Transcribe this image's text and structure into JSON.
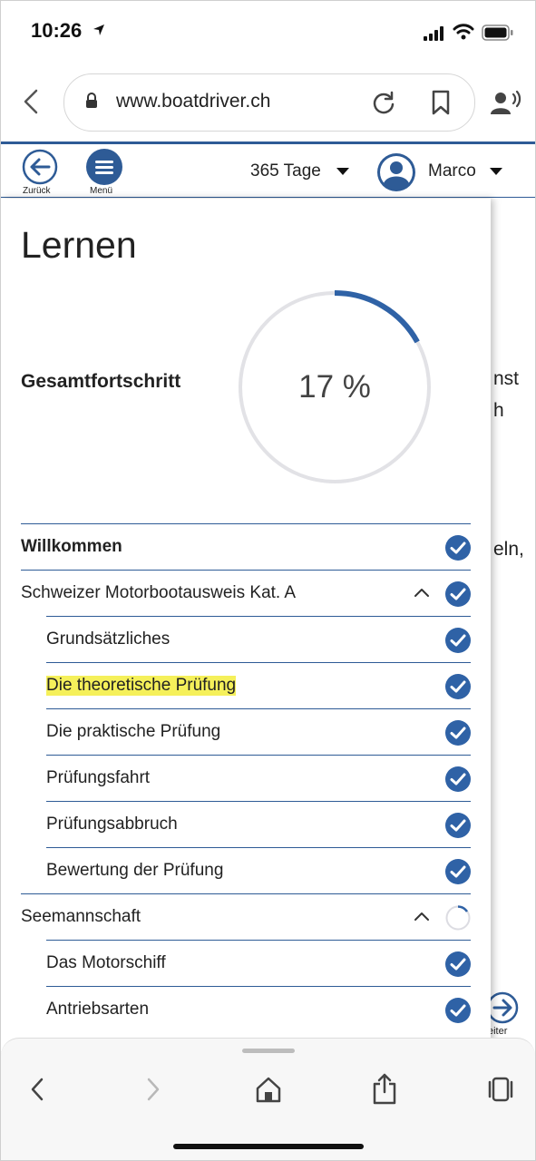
{
  "status_bar": {
    "time": "10:26"
  },
  "browser": {
    "url": "www.boatdriver.ch"
  },
  "header": {
    "back_label": "Zurück",
    "menu_label": "Menü",
    "days_label": "365 Tage",
    "user_name": "Marco"
  },
  "panel": {
    "title": "Lernen",
    "progress_label": "Gesamtfortschritt",
    "progress_text": "17 %",
    "progress_value": 17
  },
  "nav": [
    {
      "label": "Willkommen",
      "level": 0,
      "bold": true,
      "status": "done",
      "expanded": null,
      "highlight": false
    },
    {
      "label": "Schweizer Motorbootausweis Kat. A",
      "level": 0,
      "bold": false,
      "status": "done",
      "expanded": true,
      "highlight": false
    },
    {
      "label": "Grundsätzliches",
      "level": 1,
      "bold": false,
      "status": "done",
      "expanded": null,
      "highlight": false
    },
    {
      "label": "Die theoretische Prüfung",
      "level": 1,
      "bold": false,
      "status": "done",
      "expanded": null,
      "highlight": true
    },
    {
      "label": "Die praktische Prüfung",
      "level": 1,
      "bold": false,
      "status": "done",
      "expanded": null,
      "highlight": false
    },
    {
      "label": "Prüfungsfahrt",
      "level": 1,
      "bold": false,
      "status": "done",
      "expanded": null,
      "highlight": false
    },
    {
      "label": "Prüfungsabbruch",
      "level": 1,
      "bold": false,
      "status": "done",
      "expanded": null,
      "highlight": false
    },
    {
      "label": "Bewertung der Prüfung",
      "level": 1,
      "bold": false,
      "status": "done",
      "expanded": null,
      "highlight": false
    },
    {
      "label": "Seemannschaft",
      "level": 0,
      "bold": false,
      "status": "in-progress",
      "expanded": true,
      "highlight": false
    },
    {
      "label": "Das Motorschiff",
      "level": 1,
      "bold": false,
      "status": "done",
      "expanded": null,
      "highlight": false
    },
    {
      "label": "Antriebsarten",
      "level": 1,
      "bold": false,
      "status": "done",
      "expanded": null,
      "highlight": false
    }
  ],
  "background_page": {
    "fragment_1": "nst",
    "fragment_2": "h",
    "fragment_3": "eln,",
    "next_label": "eiter"
  },
  "colors": {
    "brand_blue": "#2e5b96",
    "check_blue": "#2f62a6",
    "highlight_yellow": "#f5f05a",
    "ring_track": "#e2e2e6"
  }
}
